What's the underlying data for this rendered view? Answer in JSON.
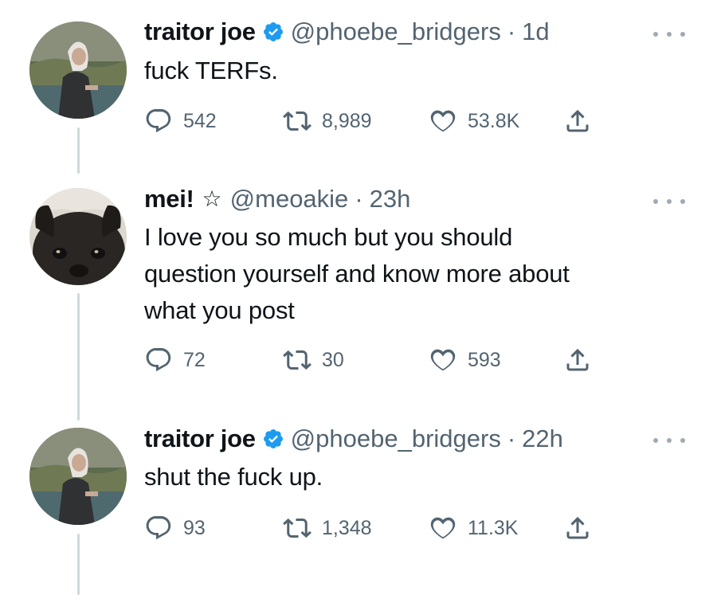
{
  "tweets": [
    {
      "name": "traitor joe",
      "verified": true,
      "handle": "@phoebe_bridgers",
      "dot": "·",
      "time": "1d",
      "text": "fuck TERFs.",
      "replies": "542",
      "retweets": "8,989",
      "likes": "53.8K"
    },
    {
      "name": "mei!",
      "star": "☆",
      "handle": "@meoakie",
      "dot": "·",
      "time": "23h",
      "text": "I love you so much but you should\nquestion yourself and know more about\nwhat you post",
      "replies": "72",
      "retweets": "30",
      "likes": "593"
    },
    {
      "name": "traitor joe",
      "verified": true,
      "handle": "@phoebe_bridgers",
      "dot": "·",
      "time": "22h",
      "text": "shut the fuck up.",
      "replies": "93",
      "retweets": "1,348",
      "likes": "11.3K"
    }
  ],
  "icons": {
    "reply": "reply-icon",
    "retweet": "retweet-icon",
    "like": "heart-icon",
    "share": "share-icon",
    "verified": "verified-badge-icon",
    "more": "more-options-icon"
  },
  "colors": {
    "text": "#0f1419",
    "muted": "#536471",
    "verified": "#1d9bf0",
    "thread_line": "#cfd9de"
  }
}
